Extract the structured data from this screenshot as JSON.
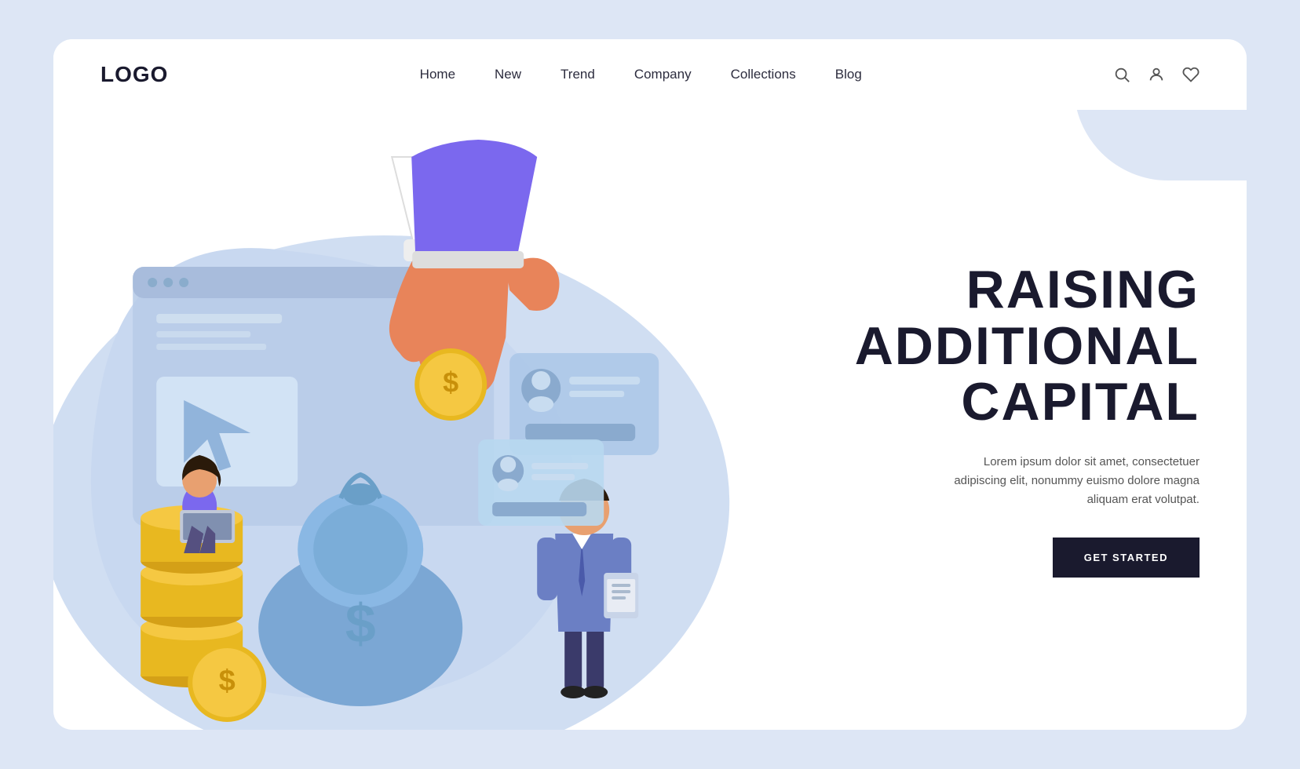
{
  "logo": "LOGO",
  "navbar": {
    "links": [
      {
        "label": "Home",
        "id": "home"
      },
      {
        "label": "New",
        "id": "new"
      },
      {
        "label": "Trend",
        "id": "trend"
      },
      {
        "label": "Company",
        "id": "company"
      },
      {
        "label": "Collections",
        "id": "collections"
      },
      {
        "label": "Blog",
        "id": "blog"
      }
    ],
    "icons": [
      {
        "name": "search-icon",
        "symbol": "🔍"
      },
      {
        "name": "user-icon",
        "symbol": "👤"
      },
      {
        "name": "heart-icon",
        "symbol": "♡"
      }
    ]
  },
  "hero": {
    "title_line1": "RAISING",
    "title_line2": "ADDITIONAL",
    "title_line3": "CAPITAL",
    "description": "Lorem ipsum dolor sit amet, consectetuer adipiscing elit, nonummy euismo dolore magna aliquam erat volutpat.",
    "cta_label": "GET STARTED"
  },
  "colors": {
    "blob": "#c8d8f0",
    "blob_inner": "#b8cce8",
    "accent_blue": "#6b9fd4",
    "money_bag": "#7ba7d4",
    "coin_gold": "#f5c842",
    "coin_dark": "#d4a017",
    "hand_skin": "#e8845a",
    "sleeve": "#ffffff",
    "person1_top": "#7b68ee",
    "person2_suit": "#6b7fc4",
    "stack_gold": "#e8a020",
    "card_bg": "#aec8e8",
    "screen_bg": "#b0c8e8"
  }
}
